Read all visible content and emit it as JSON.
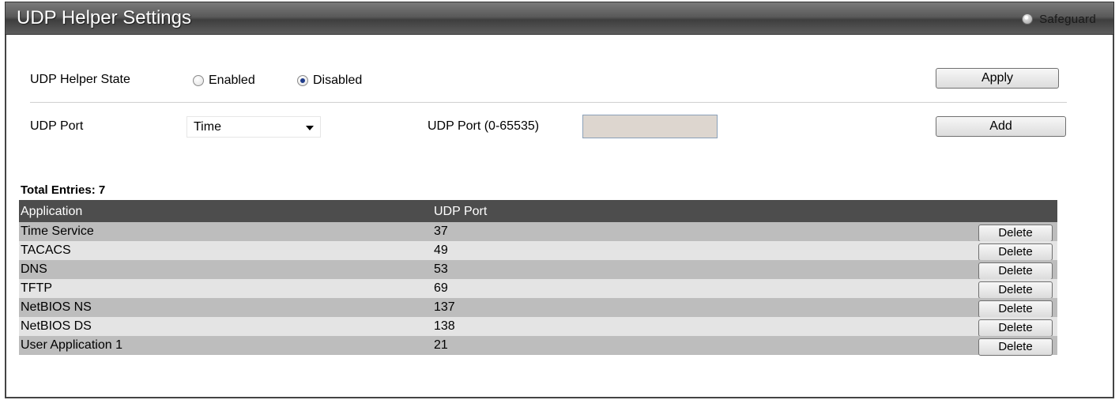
{
  "header": {
    "title": "UDP Helper Settings",
    "safeguard_label": "Safeguard"
  },
  "state_form": {
    "label": "UDP Helper State",
    "options": [
      {
        "label": "Enabled",
        "checked": false
      },
      {
        "label": "Disabled",
        "checked": true
      }
    ],
    "apply_label": "Apply"
  },
  "port_form": {
    "port_label": "UDP Port",
    "port_select_value": "Time",
    "port_range_label": "UDP Port (0-65535)",
    "port_input_value": "",
    "add_label": "Add"
  },
  "table": {
    "total_entries": "Total Entries: 7",
    "columns": [
      "Application",
      "UDP Port"
    ],
    "rows": [
      {
        "application": "Time Service",
        "port": "37"
      },
      {
        "application": "TACACS",
        "port": "49"
      },
      {
        "application": "DNS",
        "port": "53"
      },
      {
        "application": "TFTP",
        "port": "69"
      },
      {
        "application": "NetBIOS NS",
        "port": "137"
      },
      {
        "application": "NetBIOS DS",
        "port": "138"
      },
      {
        "application": "User Application 1",
        "port": "21"
      }
    ],
    "delete_label": "Delete"
  }
}
